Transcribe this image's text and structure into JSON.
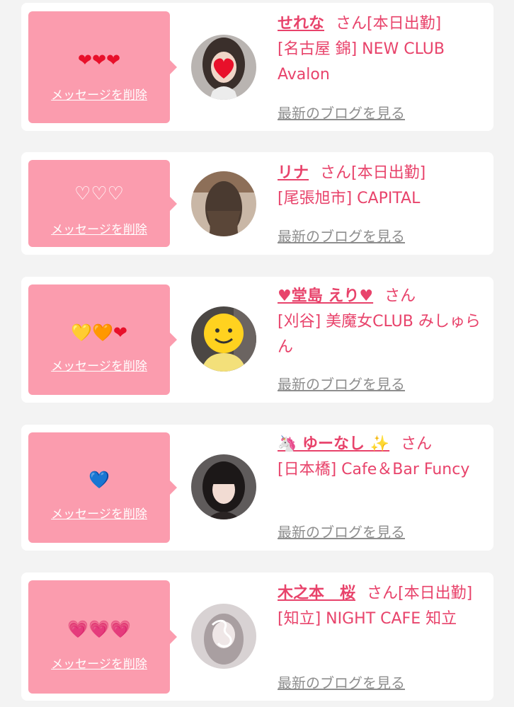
{
  "delete_label": "メッセージを削除",
  "blog_label": "最新のブログを見る",
  "entries": [
    {
      "hearts": "❤❤❤",
      "name": "せれな",
      "suffix": "さん[本日出勤]",
      "shop": "[名古屋 錦] NEW CLUB Avalon"
    },
    {
      "hearts": "♡♡♡",
      "name": "リナ",
      "suffix": "さん[本日出勤]",
      "shop": "[尾張旭市] CAPITAL"
    },
    {
      "hearts": [
        "💛",
        "🧡",
        "❤"
      ],
      "name": "♥堂島 えり♥",
      "suffix": "さん",
      "shop": "[刈谷] 美魔女CLUB みしゅらん"
    },
    {
      "hearts": "💙",
      "name": "🦄 ゆーなし ✨",
      "suffix": "さん",
      "shop": "[日本橋] Cafe＆Bar Funcy"
    },
    {
      "hearts": "💗💗💗",
      "name": "木之本　桜",
      "suffix": "さん[本日出勤]",
      "shop": "[知立] NIGHT CAFE 知立"
    }
  ],
  "colors": {
    "pink_box": "#fb9cae",
    "name_text": "#e8436b",
    "blog_link": "#8e8e8e",
    "background": "#f3f3f3"
  }
}
